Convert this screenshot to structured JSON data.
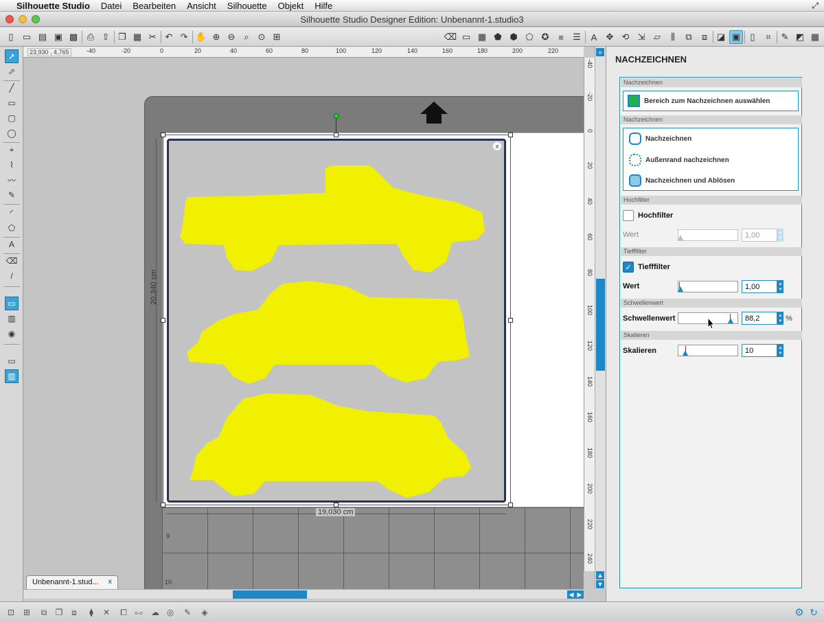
{
  "menubar": {
    "app": "Silhouette Studio",
    "items": [
      "Datei",
      "Bearbeiten",
      "Ansicht",
      "Silhouette",
      "Objekt",
      "Hilfe"
    ]
  },
  "window": {
    "title": "Silhouette Studio Designer Edition: Unbenannt-1.studio3"
  },
  "canvas": {
    "coords": "23,930 , 4,765",
    "width_label": "19,030 cm",
    "height_label": "20,340 cm",
    "hruler_ticks": [
      "-40",
      "-20",
      "0",
      "20",
      "40",
      "60",
      "80",
      "100",
      "120",
      "140",
      "160",
      "180",
      "200",
      "220"
    ],
    "vruler_ticks": [
      "-40",
      "-20",
      "0",
      "20",
      "40",
      "60",
      "80",
      "100",
      "120",
      "140",
      "160",
      "180",
      "200",
      "220",
      "240"
    ],
    "mat_labels": [
      "9",
      "10"
    ]
  },
  "doc_tab": {
    "label": "Unbenannt-1.stud...",
    "close": "x"
  },
  "panel": {
    "title": "NACHZEICHNEN",
    "sec_area": "Nachzeichnen",
    "btn_select_area": "Bereich zum Nachzeichnen auswählen",
    "sec_trace": "Nachzeichnen",
    "opt_trace": "Nachzeichnen",
    "opt_outer": "Außenrand nachzeichnen",
    "opt_detach": "Nachzeichnen und Ablösen",
    "sec_highpass": "Hochfilter",
    "highpass_check": "Hochfilter",
    "highpass_label": "Wert",
    "highpass_value": "1,00",
    "sec_lowpass": "Tiefffilter",
    "lowpass_check": "Tiefffilter",
    "lowpass_label": "Wert",
    "lowpass_value": "1,00",
    "sec_threshold": "Schwellenwert",
    "threshold_label": "Schwellenwert",
    "threshold_value": "88,2",
    "threshold_unit": "%",
    "threshold_level": 0.88,
    "sec_scale": "Skalieren",
    "scale_label": "Skalieren",
    "scale_value": "10"
  },
  "colors": {
    "accent": "#1e88c7",
    "trace_fill": "#f0f000"
  }
}
